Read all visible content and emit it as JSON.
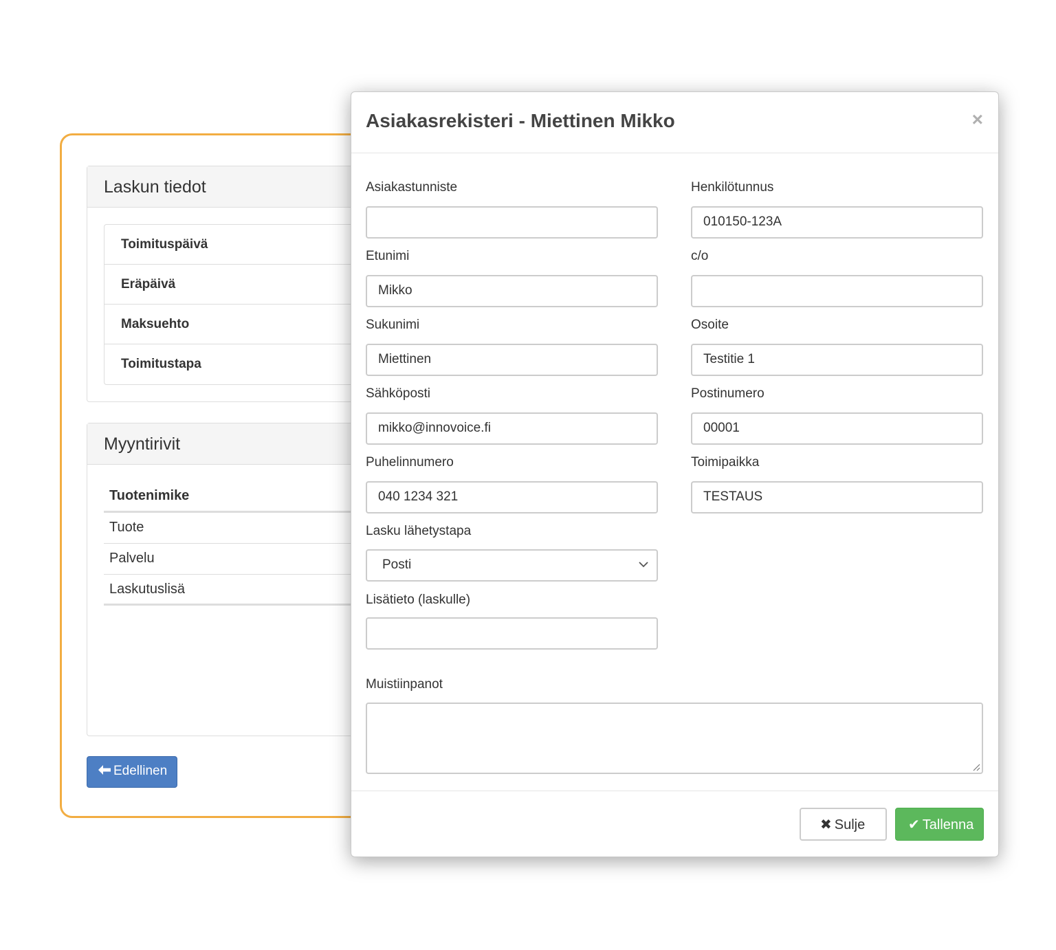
{
  "background": {
    "invoice_panel": {
      "title": "Laskun tiedot",
      "items": [
        "Toimituspäivä",
        "Eräpäivä",
        "Maksuehto",
        "Toimitustapa"
      ]
    },
    "sales_panel": {
      "title": "Myyntirivit",
      "column_header": "Tuotenimike",
      "rows": [
        "Tuote",
        "Palvelu",
        "Laskutuslisä"
      ]
    },
    "prev_button": {
      "label": "Edellinen",
      "icon": "arrow-left-icon"
    }
  },
  "modal": {
    "title": "Asiakasrekisteri - Miettinen Mikko",
    "close_symbol": "×",
    "fields": {
      "customer_id": {
        "label": "Asiakastunniste",
        "value": ""
      },
      "ssn": {
        "label": "Henkilötunnus",
        "value": "010150-123A"
      },
      "first_name": {
        "label": "Etunimi",
        "value": "Mikko"
      },
      "care_of": {
        "label": "c/o",
        "value": ""
      },
      "last_name": {
        "label": "Sukunimi",
        "value": "Miettinen"
      },
      "address": {
        "label": "Osoite",
        "value": "Testitie 1"
      },
      "email": {
        "label": "Sähköposti",
        "value": "mikko@innovoice.fi"
      },
      "postal_code": {
        "label": "Postinumero",
        "value": "00001"
      },
      "phone": {
        "label": "Puhelinnumero",
        "value": "040 1234 321"
      },
      "city": {
        "label": "Toimipaikka",
        "value": "TESTAUS"
      },
      "delivery_method": {
        "label": "Lasku lähetystapa",
        "value": "Posti"
      },
      "invoice_note": {
        "label": "Lisätieto (laskulle)",
        "value": ""
      },
      "notes": {
        "label": "Muistiinpanot",
        "value": ""
      }
    },
    "footer": {
      "close_button": {
        "label": "Sulje",
        "icon": "x-icon",
        "symbol": "✖"
      },
      "save_button": {
        "label": "Tallenna",
        "icon": "check-icon",
        "symbol": "✔"
      }
    }
  },
  "colors": {
    "card_border": "#f2ad42",
    "primary_button": "#4d7fc4",
    "success_button": "#5cb85c"
  }
}
